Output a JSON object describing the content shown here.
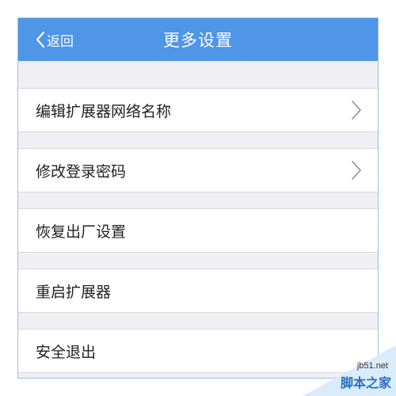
{
  "nav": {
    "back_label": "返回",
    "title": "更多设置"
  },
  "menu": {
    "items": [
      {
        "label": "编辑扩展器网络名称",
        "chevron": true
      },
      {
        "label": "修改登录密码",
        "chevron": true
      },
      {
        "label": "恢复出厂设置",
        "chevron": false
      },
      {
        "label": "重启扩展器",
        "chevron": false
      },
      {
        "label": "安全退出",
        "chevron": false
      }
    ]
  },
  "watermark": {
    "url": "jb51.net",
    "brand": "脚本之家"
  },
  "colors": {
    "nav_bg": "#4f95e8",
    "list_bg": "#efeff4",
    "row_bg": "#ffffff",
    "chevron": "#8e8e93"
  }
}
